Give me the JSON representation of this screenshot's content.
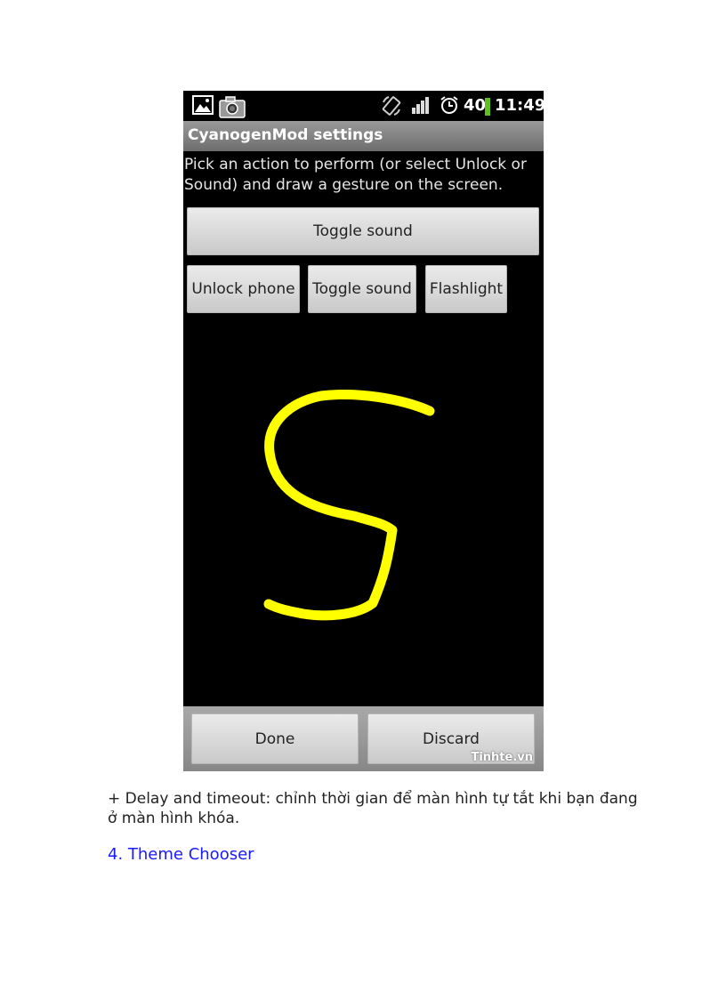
{
  "status_bar": {
    "signal_label": "40",
    "time": "11:49",
    "icons": [
      "gallery-icon",
      "camera-icon",
      "rotate-icon",
      "signal-icon",
      "alarm-icon",
      "battery-icon"
    ]
  },
  "app": {
    "title": "CyanogenMod settings",
    "instruction": "Pick an action to perform (or select Unlock or Sound) and draw a gesture on the screen.",
    "selected_action": "Toggle sound",
    "actions": [
      "Unlock phone",
      "Toggle sound",
      "Flashlight"
    ],
    "gesture_color": "#ffff00",
    "done_label": "Done",
    "discard_label": "Discard",
    "watermark": "Tinhte.vn"
  },
  "document": {
    "paragraph": "+ Delay and timeout: chỉnh thời gian để màn hình tự tắt khi bạn đang ở màn hình khóa.",
    "heading": "4. Theme Chooser",
    "heading_color": "#1a1aff"
  }
}
